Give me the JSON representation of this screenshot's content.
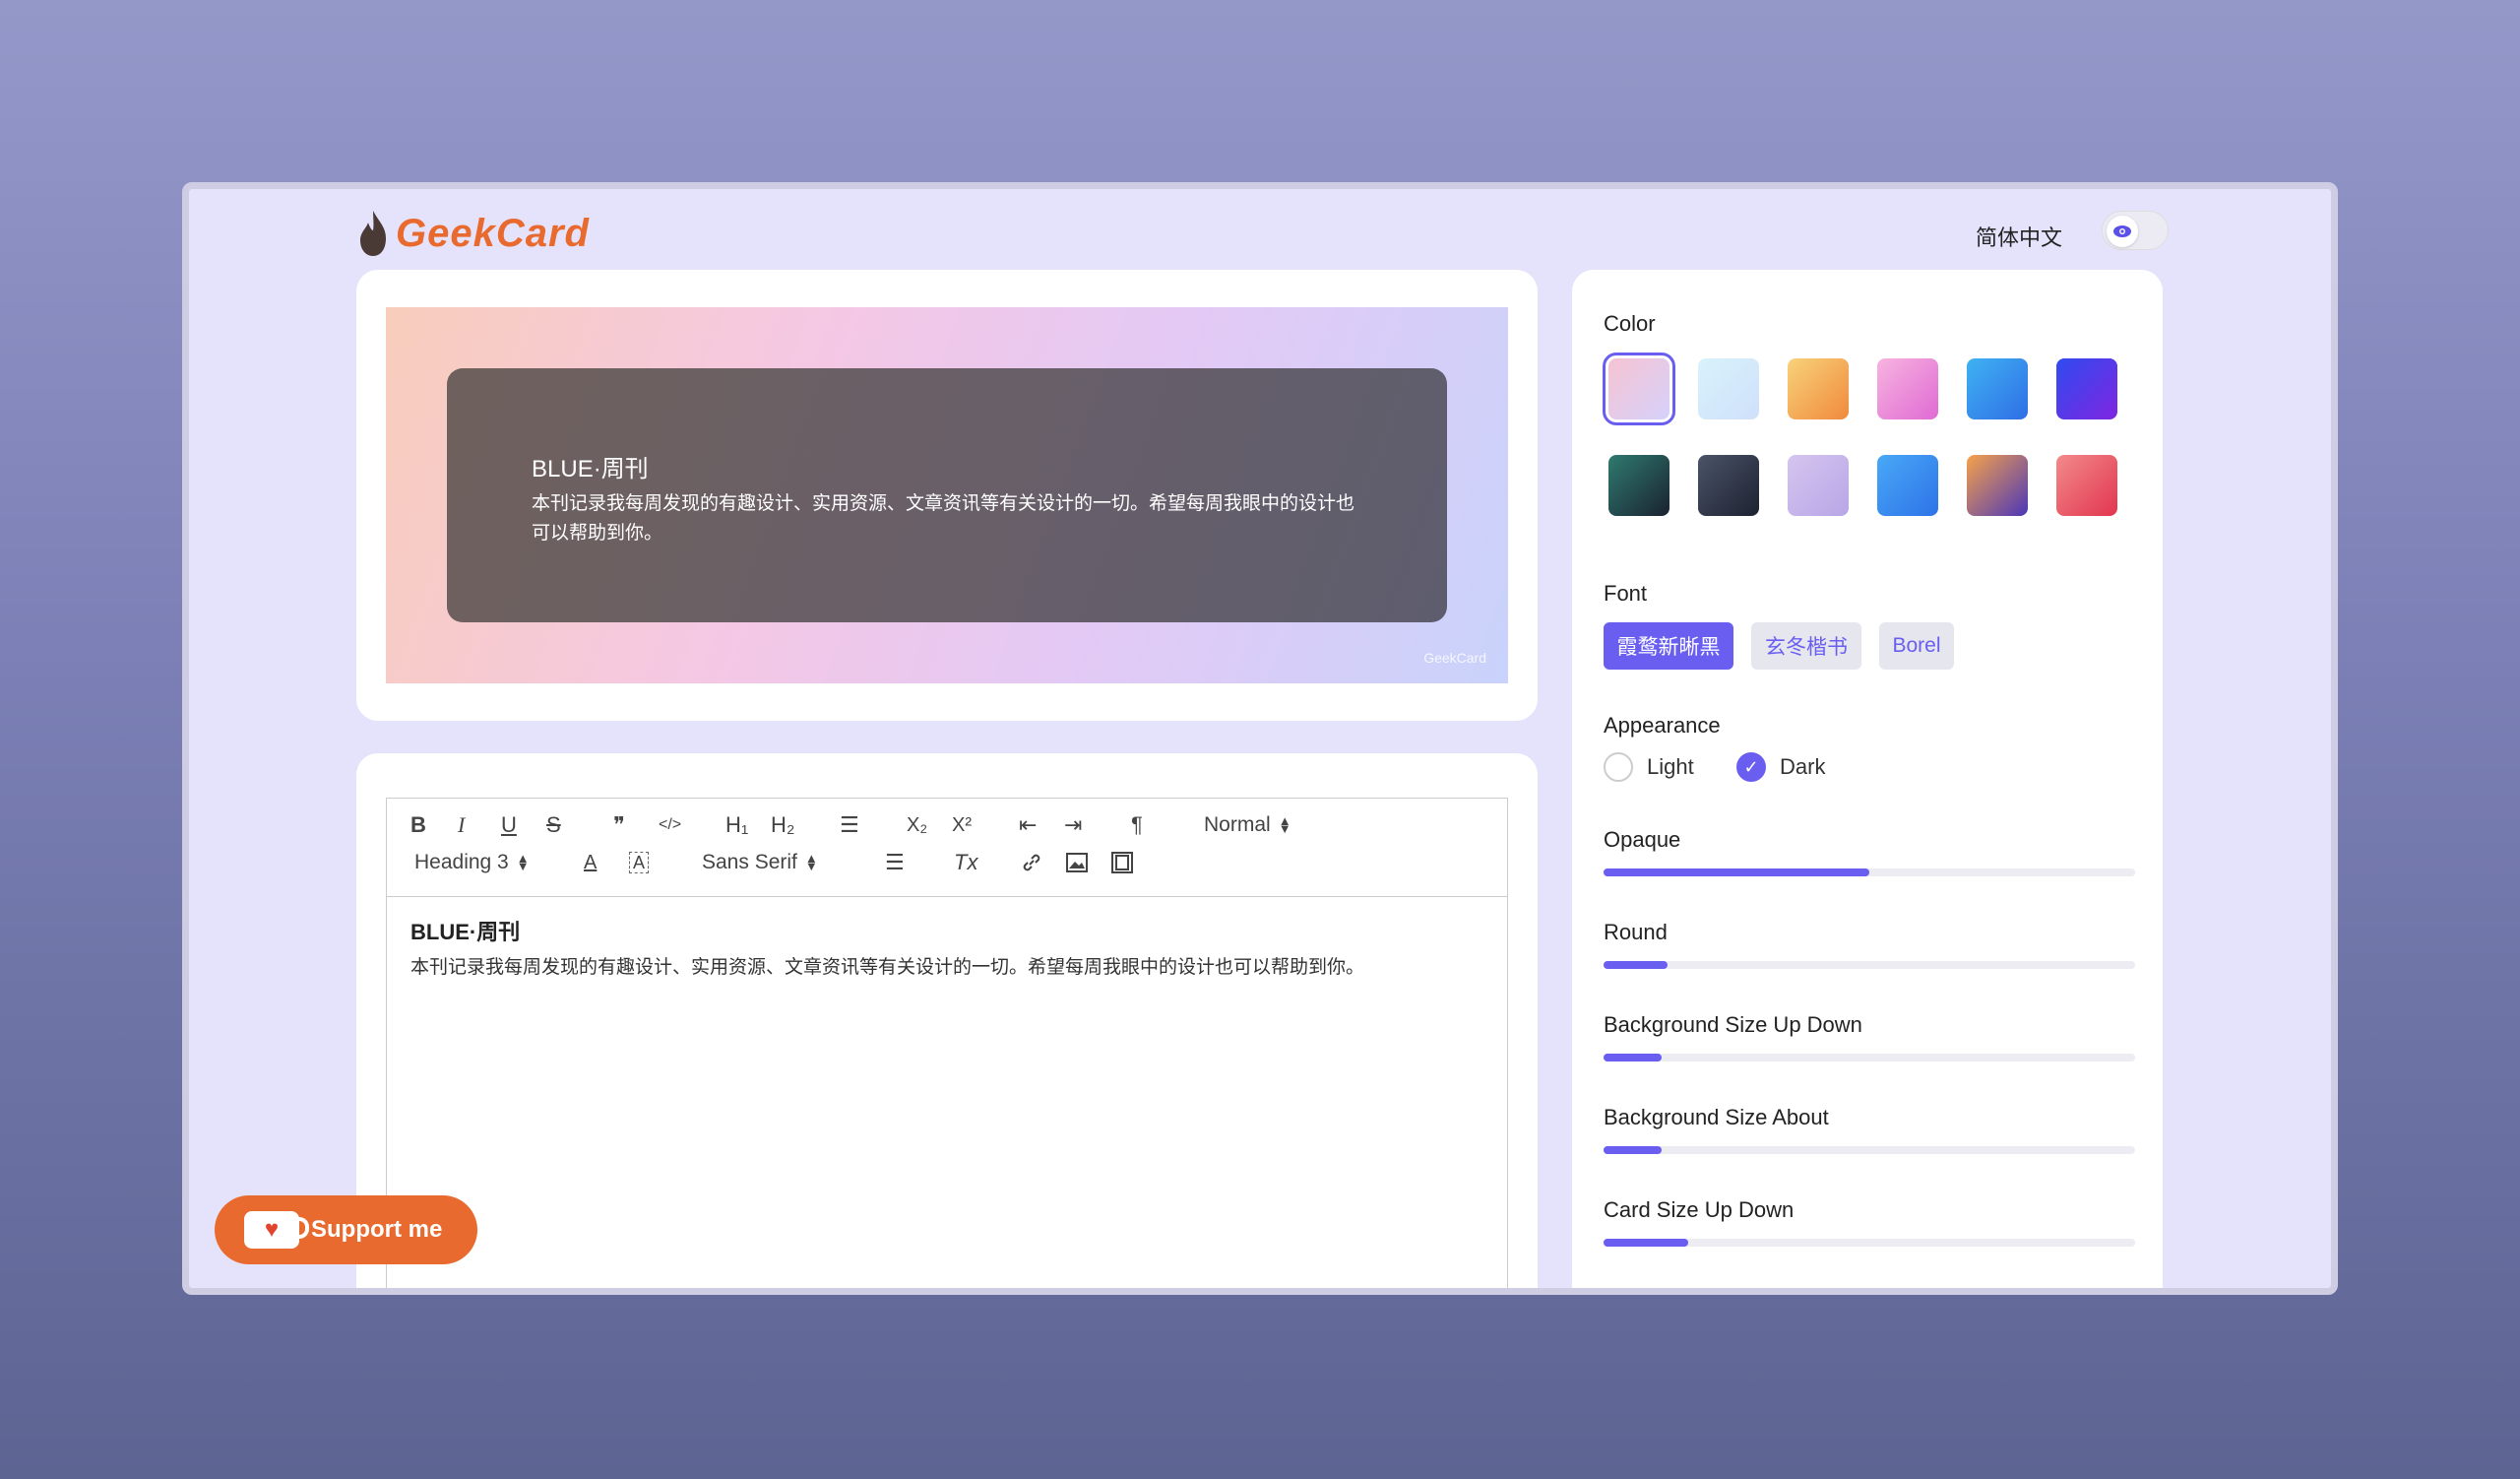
{
  "app": {
    "name": "GeekCard"
  },
  "header": {
    "language": "简体中文"
  },
  "preview": {
    "card_title": "BLUE·周刊",
    "card_body": "本刊记录我每周发现的有趣设计、实用资源、文章资讯等有关设计的一切。希望每周我眼中的设计也可以帮助到你。",
    "watermark": "GeekCard"
  },
  "editor": {
    "toolbar": {
      "bold": "B",
      "italic": "I",
      "underline": "U",
      "strike": "S",
      "quote": "❞",
      "code": "</>",
      "h1": "H₁",
      "h2": "H₂",
      "list": "☰",
      "subscript": "X₂",
      "superscript": "X²",
      "outdent": "⇤",
      "indent": "⇥",
      "direction": "¶",
      "size_select": "Normal",
      "header_select": "Heading 3",
      "font_select": "Sans Serif",
      "clean": "Tx"
    },
    "content_title": "BLUE·周刊",
    "content_body": "本刊记录我每周发现的有趣设计、实用资源、文章资讯等有关设计的一切。希望每周我眼中的设计也可以帮助到你。"
  },
  "settings": {
    "color_label": "Color",
    "colors": [
      {
        "from": "#f6c3d2",
        "to": "#d6d1fb"
      },
      {
        "from": "#d8f3fb",
        "to": "#cfe0fb"
      },
      {
        "from": "#f8d27a",
        "to": "#f08a3c"
      },
      {
        "from": "#f7b4df",
        "to": "#e06ad4"
      },
      {
        "from": "#3fb2f2",
        "to": "#2f6ee6"
      },
      {
        "from": "#2f4bf0",
        "to": "#7f26e0"
      },
      {
        "from": "#2f7a6f",
        "to": "#1a2230"
      },
      {
        "from": "#4a5368",
        "to": "#1d2230"
      },
      {
        "from": "#d5c5ef",
        "to": "#b7a6e6"
      },
      {
        "from": "#49a8f6",
        "to": "#2d73e8"
      },
      {
        "from": "#f6a24a",
        "to": "#4b36b8"
      },
      {
        "from": "#f28a8a",
        "to": "#e2354f"
      }
    ],
    "font_label": "Font",
    "fonts": [
      "霞鹜新晰黑",
      "玄冬楷书",
      "Borel"
    ],
    "appearance_label": "Appearance",
    "appearance_light": "Light",
    "appearance_dark": "Dark",
    "opaque_label": "Opaque",
    "opaque_value": 0.5,
    "round_label": "Round",
    "round_value": 0.12,
    "bg_updown_label": "Background Size Up Down",
    "bg_updown_value": 0.11,
    "bg_about_label": "Background Size About",
    "bg_about_value": 0.11,
    "card_updown_label": "Card Size Up Down",
    "card_updown_value": 0.16
  },
  "support": {
    "label": "Support me"
  }
}
